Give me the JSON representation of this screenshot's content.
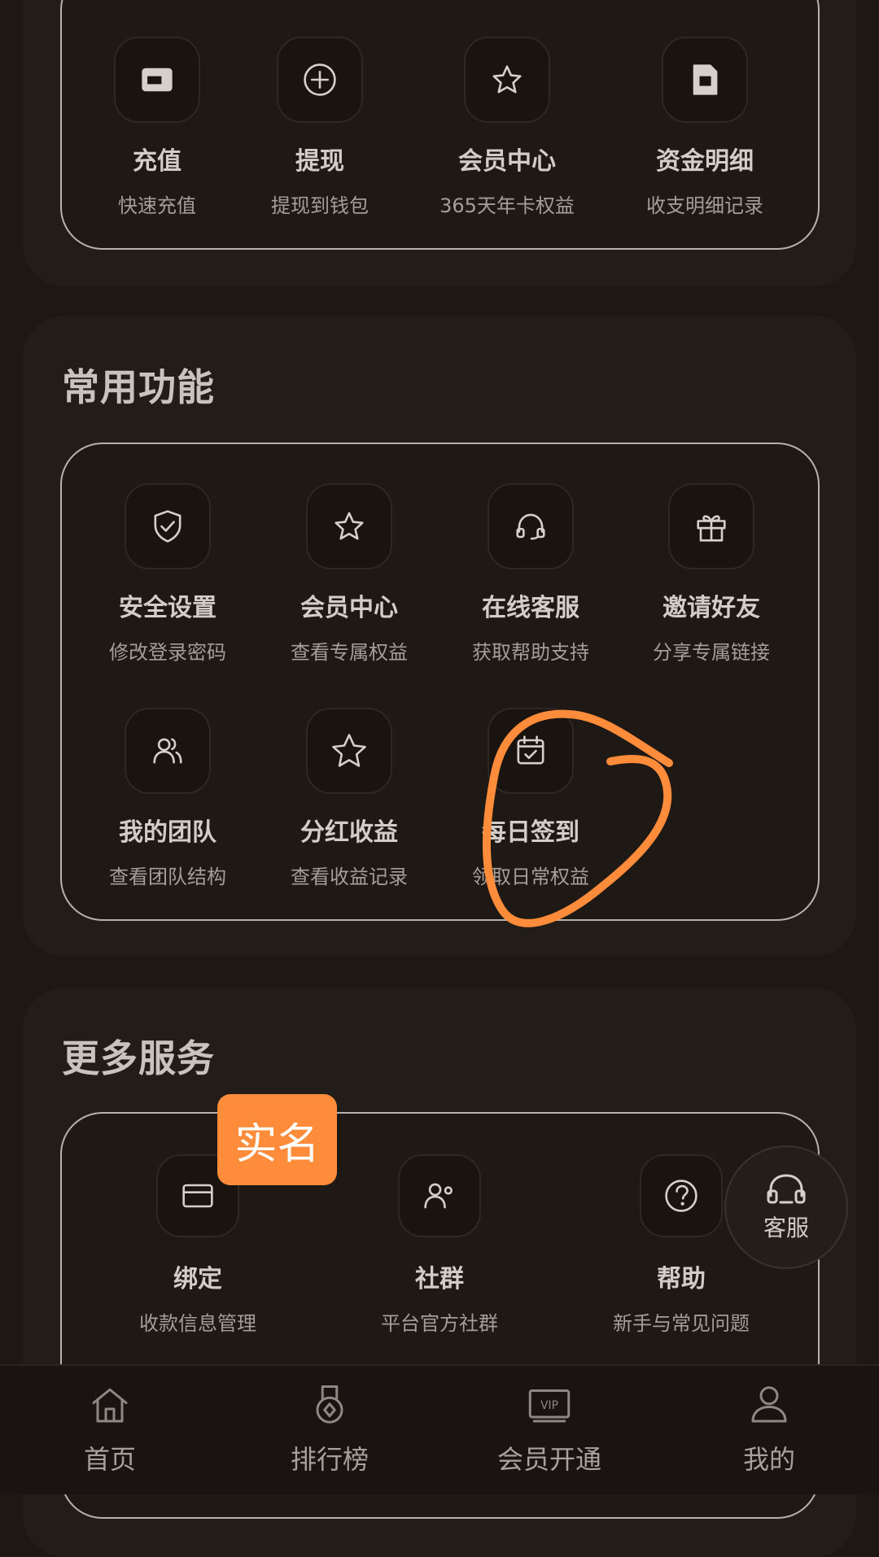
{
  "wallet": {
    "items": [
      {
        "label": "充值",
        "sub": "快速充值",
        "icon": "wallet-card-icon"
      },
      {
        "label": "提现",
        "sub": "提现到钱包",
        "icon": "plus-circle-icon"
      },
      {
        "label": "会员中心",
        "sub": "365天年卡权益",
        "icon": "star-icon"
      },
      {
        "label": "资金明细",
        "sub": "收支明细记录",
        "icon": "document-icon"
      }
    ]
  },
  "common": {
    "title": "常用功能",
    "items": [
      {
        "label": "安全设置",
        "sub": "修改登录密码",
        "icon": "shield-check-icon"
      },
      {
        "label": "会员中心",
        "sub": "查看专属权益",
        "icon": "star-icon"
      },
      {
        "label": "在线客服",
        "sub": "获取帮助支持",
        "icon": "headset-icon"
      },
      {
        "label": "邀请好友",
        "sub": "分享专属链接",
        "icon": "gift-icon"
      },
      {
        "label": "我的团队",
        "sub": "查看团队结构",
        "icon": "team-icon"
      },
      {
        "label": "分红收益",
        "sub": "查看收益记录",
        "icon": "star-outline-icon"
      },
      {
        "label": "每日签到",
        "sub": "领取日常权益",
        "icon": "calendar-check-icon"
      }
    ]
  },
  "more": {
    "title": "更多服务",
    "badge": "实名",
    "items": [
      {
        "label": "绑定",
        "sub": "收款信息管理",
        "icon": "card-icon"
      },
      {
        "label": "社群",
        "sub": "平台官方社群",
        "icon": "group-icon"
      },
      {
        "label": "帮助",
        "sub": "新手与常见问题",
        "icon": "help-circle-icon"
      }
    ]
  },
  "float_service": {
    "label": "客服",
    "icon": "headset-icon"
  },
  "tabbar": {
    "items": [
      {
        "label": "首页",
        "icon": "home-icon"
      },
      {
        "label": "排行榜",
        "icon": "medal-icon"
      },
      {
        "label": "会员开通",
        "icon": "vip-icon"
      },
      {
        "label": "我的",
        "icon": "user-icon"
      }
    ]
  },
  "colors": {
    "background": "#1e1815",
    "card": "#231d19",
    "accent": "#ff8c3a"
  }
}
